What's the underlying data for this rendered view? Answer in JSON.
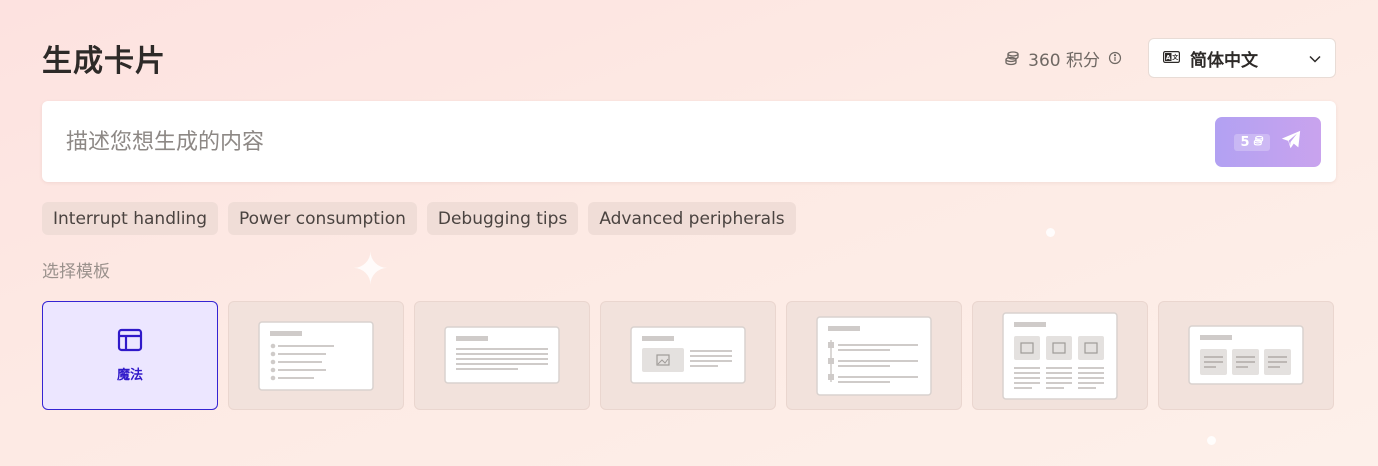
{
  "page": {
    "title": "生成卡片"
  },
  "credits": {
    "value": "360 积分",
    "icon": "coins-icon",
    "info_icon": "info-icon"
  },
  "language": {
    "selected": "简体中文",
    "icon": "translate-icon"
  },
  "prompt": {
    "placeholder": "描述您想生成的内容",
    "value": "",
    "send_cost": "5"
  },
  "suggestions": [
    "Interrupt handling",
    "Power consumption",
    "Debugging tips",
    "Advanced peripherals"
  ],
  "templates": {
    "label": "选择模板",
    "active_label": "魔法",
    "items": [
      "magic",
      "bullet-list",
      "text-block",
      "image-text",
      "timeline",
      "three-image-columns",
      "three-card-columns"
    ]
  },
  "colors": {
    "accent": "#3524d3",
    "send_gradient_start": "#b2a1f2",
    "send_gradient_end": "#c9a3ee",
    "chip_bg": "#f0ddd7",
    "template_bg": "#f2e2dc",
    "active_template_bg": "#ece6ff"
  }
}
